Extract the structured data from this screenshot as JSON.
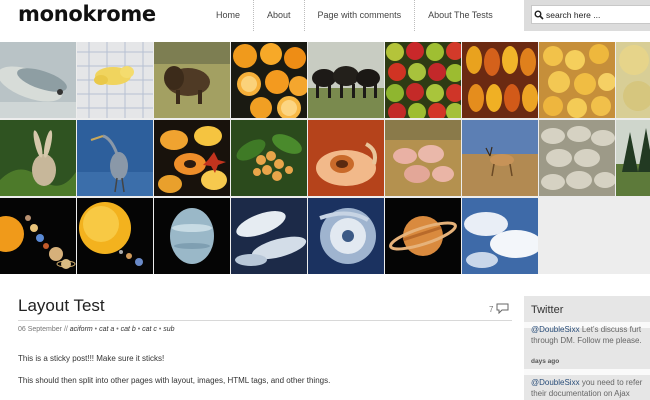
{
  "site": {
    "logo": "monokrome"
  },
  "nav": {
    "items": [
      "Home",
      "About",
      "Page with comments",
      "About The Tests"
    ]
  },
  "search": {
    "placeholder": "search here ..."
  },
  "gallery": {
    "rows": [
      [
        "fish",
        "chicks-on-plate",
        "bison",
        "oranges",
        "cattle",
        "apples",
        "mangoes",
        "ducklings",
        "melons"
      ],
      [
        "rabbit",
        "heron",
        "papayas",
        "berries",
        "peach",
        "piglets",
        "antelope",
        "sheep",
        "forest"
      ],
      [
        "solar-system",
        "sun",
        "neptune",
        "earth-clouds",
        "hurricane",
        "saturn",
        "clouds"
      ]
    ]
  },
  "post": {
    "title": "Layout Test",
    "comment_count": "7",
    "date": "06 September",
    "separator": "//",
    "categories": [
      "aciform",
      "cat a",
      "cat b",
      "cat c",
      "sub"
    ],
    "paragraphs": [
      "This is a sticky post!!! Make sure it sticks!",
      "This should then split into other pages with layout, images, HTML tags, and other things."
    ]
  },
  "sidebar": {
    "title": "Twitter",
    "tweets": [
      {
        "user": "@DoubleSixx",
        "line1": "Let's discuss furt",
        "line2": "through DM. Follow me please.",
        "time": "days ago"
      },
      {
        "user": "@DoubleSixx",
        "line1": "you need to refer",
        "line2": "their documentation on Ajax",
        "time": ""
      }
    ]
  },
  "colors": {
    "header_bg": "#ffffff",
    "gallery_bg": "#ededed",
    "sidebar_bg": "#e6e6e6",
    "link": "#2a4e7a"
  }
}
